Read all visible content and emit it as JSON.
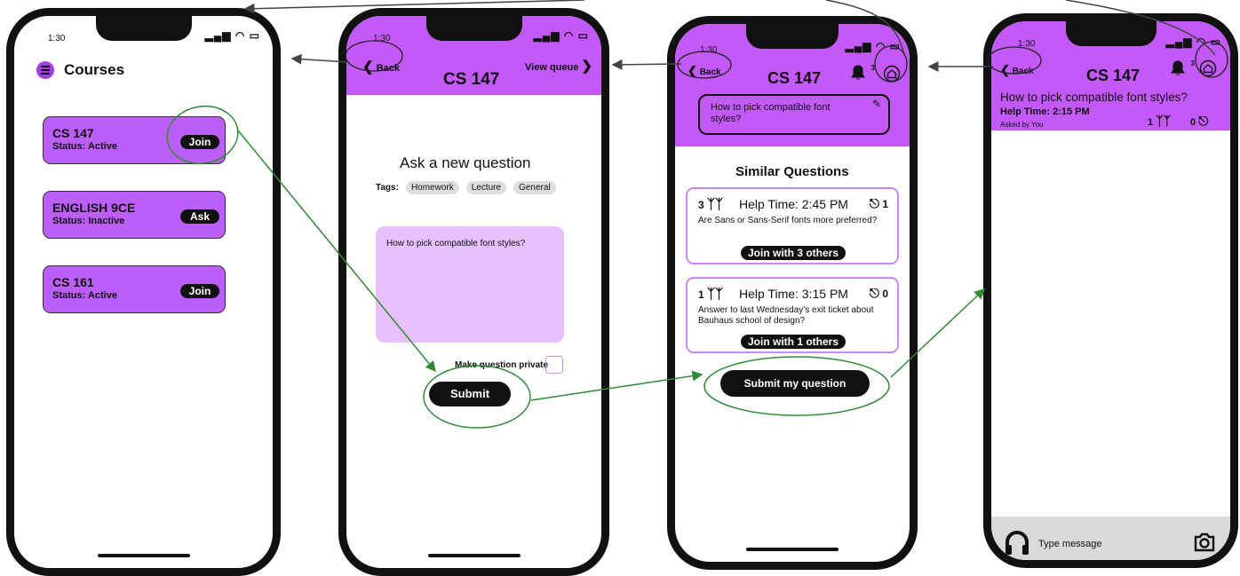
{
  "colors": {
    "purple": "#c459fa",
    "light_purple": "#e6c1fd",
    "annotation_green": "#2f8a35",
    "arrow_gray": "#444444"
  },
  "status_bar": {
    "time": "1:30",
    "signal": "▂▄▆ ◠ ▭"
  },
  "screen1": {
    "title": "Courses",
    "courses": [
      {
        "name": "CS 147",
        "status": "Status: Active",
        "action": "Join"
      },
      {
        "name": "ENGLISH 9CE",
        "status": "Status: Inactive",
        "action": "Ask"
      },
      {
        "name": "CS 161",
        "status": "Status: Active",
        "action": "Join"
      }
    ]
  },
  "screen2": {
    "back": "Back",
    "view_queue": "View queue",
    "course": "CS 147",
    "heading": "Ask a new question",
    "tags_label": "Tags:",
    "tags": [
      "Homework",
      "Lecture",
      "General"
    ],
    "question_text": "How to pick compatible font styles?",
    "private_label": "Make question private",
    "submit": "Submit"
  },
  "screen3": {
    "back": "Back",
    "course": "CS 147",
    "notif_count": "3",
    "question": "How to pick compatible font styles?",
    "similar_heading": "Similar Questions",
    "similar": [
      {
        "count": "3",
        "time": "Help Time: 2:45 PM",
        "listeners": "1",
        "text": "Are Sans or Sans-Serif fonts more preferred?",
        "join": "Join with 3 others"
      },
      {
        "count": "1",
        "time": "Help Time: 3:15 PM",
        "listeners": "0",
        "text": "Answer to last Wednesday’s exit ticket about Bauhaus school of design?",
        "join": "Join with 1 others"
      }
    ],
    "submit": "Submit my question"
  },
  "screen4": {
    "back": "Back",
    "course": "CS 147",
    "notif_count": "3",
    "question": "How to pick compatible font styles?",
    "help_time": "Help Time: 2:15 PM",
    "asked_by": "Asked by You",
    "group_count": "1",
    "listener_count": "0",
    "message_placeholder": "Type message"
  }
}
